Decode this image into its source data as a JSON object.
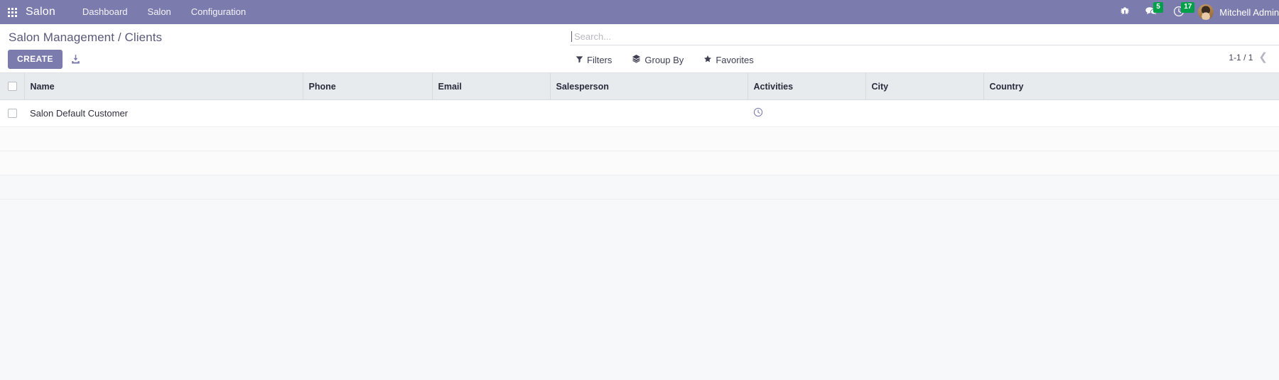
{
  "navbar": {
    "apps_icon": "apps-grid-icon",
    "brand": "Salon",
    "menu": [
      {
        "label": "Dashboard"
      },
      {
        "label": "Salon"
      },
      {
        "label": "Configuration"
      }
    ],
    "right": {
      "debug_icon": "bug-icon",
      "messages_icon": "messages-icon",
      "messages_count": "5",
      "activities_icon": "clock-icon",
      "activities_count": "17",
      "avatar": "user-avatar",
      "user_name": "Mitchell Admin ("
    },
    "background_color": "#7c7bad",
    "badge_color": "#00a04a"
  },
  "control_panel": {
    "breadcrumb": "Salon Management / Clients",
    "create_label": "CREATE",
    "import_icon": "import-icon",
    "search": {
      "placeholder": "Search...",
      "value": ""
    },
    "filters": [
      {
        "label": "Filters",
        "icon": "funnel-icon"
      },
      {
        "label": "Group By",
        "icon": "layers-icon"
      },
      {
        "label": "Favorites",
        "icon": "star-icon"
      }
    ],
    "pager": {
      "range": "1-1 / 1",
      "prev_icon": "chevron-left-icon"
    }
  },
  "list": {
    "columns": [
      "Name",
      "Phone",
      "Email",
      "Salesperson",
      "Activities",
      "City",
      "Country"
    ],
    "rows": [
      {
        "name": "Salon Default Customer",
        "phone": "",
        "email": "",
        "salesperson": "",
        "activities_icon": "clock-icon",
        "city": "",
        "country": ""
      }
    ],
    "empty_row_count": 3,
    "accent_color": "#7c7bad",
    "header_background": "#e7ebee"
  }
}
